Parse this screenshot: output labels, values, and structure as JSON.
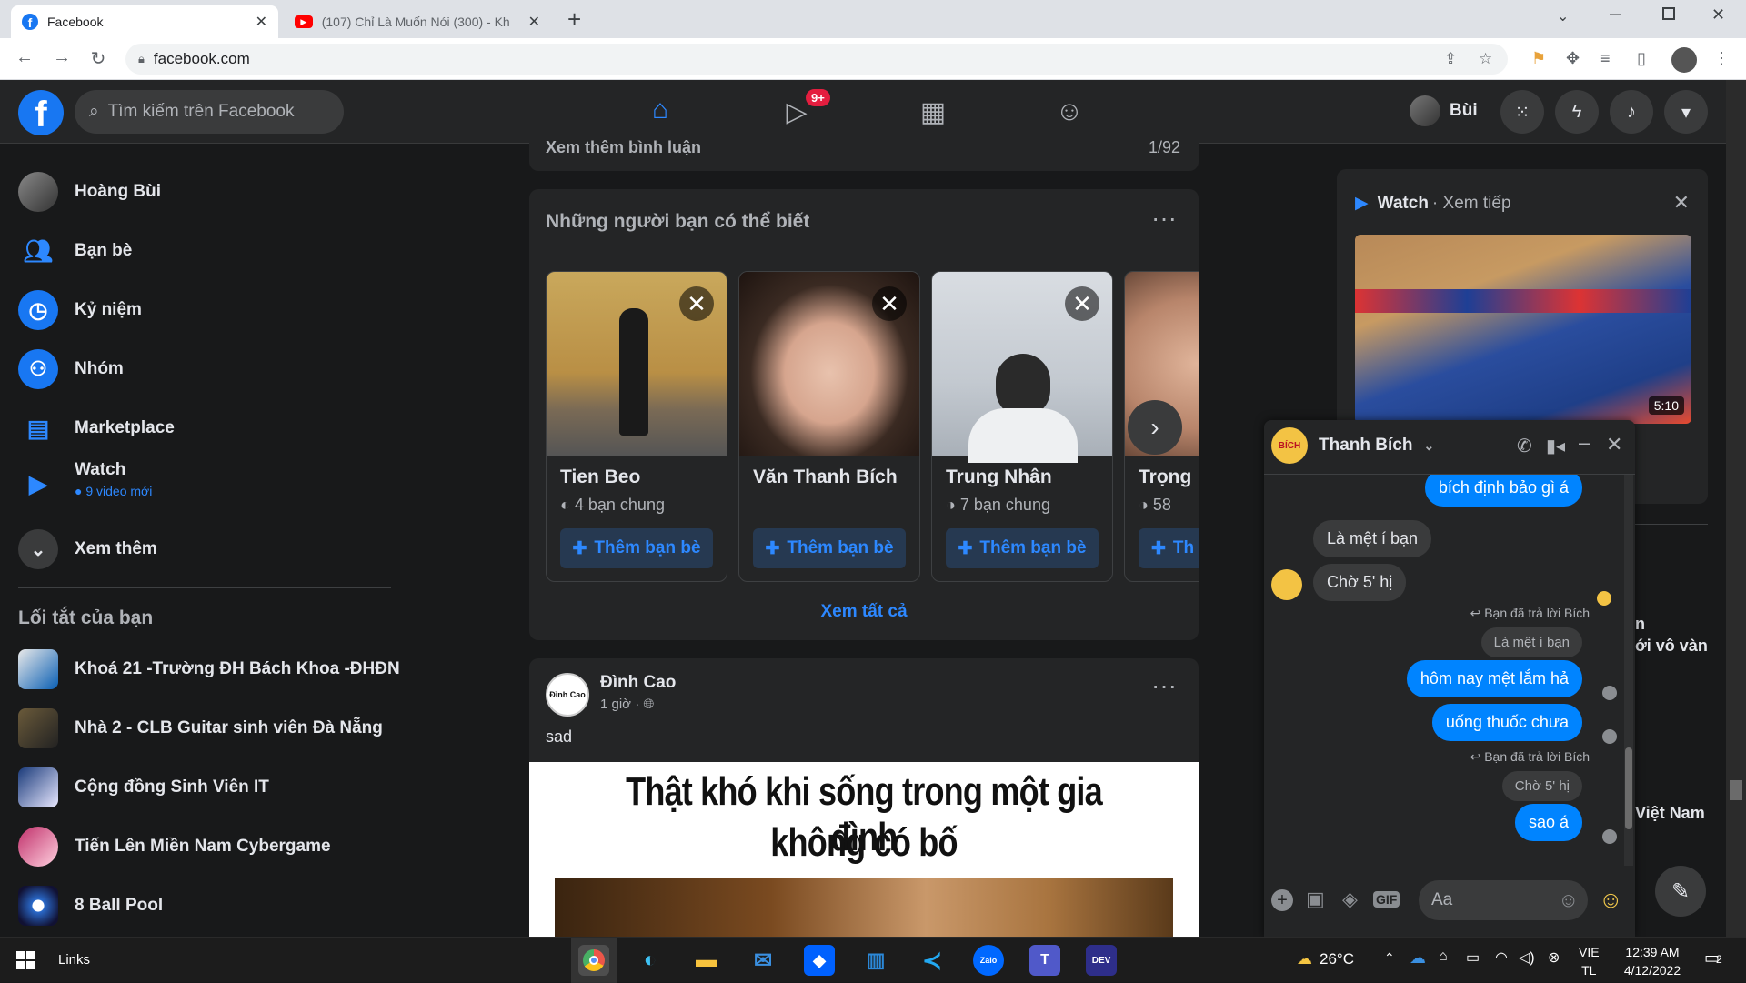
{
  "browser": {
    "tabs": [
      {
        "title": "Facebook",
        "active": true
      },
      {
        "title": "(107) Chỉ Là Muốn Nói (300) - Kh",
        "active": false
      }
    ],
    "url": "facebook.com"
  },
  "fb_header": {
    "search_placeholder": "Tìm kiếm trên Facebook",
    "watch_badge": "9+",
    "profile_name": "Bùi"
  },
  "sidebar": {
    "items": [
      {
        "label": "Hoàng Bùi"
      },
      {
        "label": "Bạn bè"
      },
      {
        "label": "Kỷ niệm"
      },
      {
        "label": "Nhóm"
      },
      {
        "label": "Marketplace"
      },
      {
        "label": "Watch",
        "sub": "9 video mới"
      },
      {
        "label": "Xem thêm"
      }
    ],
    "shortcuts_title": "Lối tắt của bạn",
    "shortcuts": [
      {
        "label": "Khoá 21 -Trường ĐH Bách Khoa -ĐHĐN"
      },
      {
        "label": "Nhà 2 - CLB Guitar sinh viên Đà Nẵng"
      },
      {
        "label": "Cộng đồng Sinh Viên IT"
      },
      {
        "label": "Tiến Lên Miền Nam Cybergame"
      },
      {
        "label": "8 Ball Pool"
      }
    ]
  },
  "feed": {
    "prev_post": {
      "more_comments": "Xem thêm bình luận",
      "count": "1/92"
    },
    "pymk": {
      "title": "Những người bạn có thể biết",
      "add_label": "Thêm bạn bè",
      "see_all": "Xem tất cả",
      "people": [
        {
          "name": "Tien Beo",
          "mutual": "4 bạn chung"
        },
        {
          "name": "Văn Thanh Bích",
          "mutual": ""
        },
        {
          "name": "Trung Nhân",
          "mutual": "7 bạn chung"
        },
        {
          "name": "Trọng",
          "mutual": "58",
          "add_label": "Th"
        }
      ]
    },
    "post": {
      "author": "Đình Cao",
      "avatar_text": "Đình Cao",
      "time": "1 giờ ·",
      "text": "sad",
      "image_caption_line1": "Thật khó khi sống trong một gia đình",
      "image_caption_line2": "không có bố"
    }
  },
  "right_col": {
    "watch_title": "Watch",
    "watch_sub": "· Xem tiếp",
    "video_duration": "5:10",
    "partial_texts": [
      "n",
      "ới vô vàn",
      "Việt Nam"
    ]
  },
  "chat": {
    "contact": "Thanh Bích",
    "avatar_text": "BÍCH",
    "input_placeholder": "Aa",
    "messages": [
      {
        "text": "bích định bảo gì á",
        "dir": "out"
      },
      {
        "text": "Là mệt í bạn",
        "dir": "in"
      },
      {
        "text": "Chờ 5' hị",
        "dir": "in"
      },
      {
        "replied": "Bạn đã trả lời Bích",
        "quote": "Là mệt í bạn"
      },
      {
        "text": "hôm nay mệt lắm hả",
        "dir": "out"
      },
      {
        "text": "uống thuốc chưa",
        "dir": "out"
      },
      {
        "replied": "Bạn đã trả lời Bích",
        "quote": "Chờ 5' hị"
      },
      {
        "text": "sao á",
        "dir": "out"
      }
    ]
  },
  "taskbar": {
    "links": "Links",
    "weather": "26°C",
    "lang1": "VIE",
    "lang2": "TL",
    "time": "12:39 AM",
    "date": "4/12/2022",
    "notif": "2",
    "apps": [
      "chrome",
      "edge",
      "explorer",
      "mail",
      "dropbox",
      "store",
      "vscode",
      "Zalo",
      "teams",
      "DEV"
    ]
  },
  "colors": {
    "fb_blue": "#1877f2",
    "messenger_blue": "#0084ff",
    "bg": "#18191a",
    "card": "#242526"
  }
}
